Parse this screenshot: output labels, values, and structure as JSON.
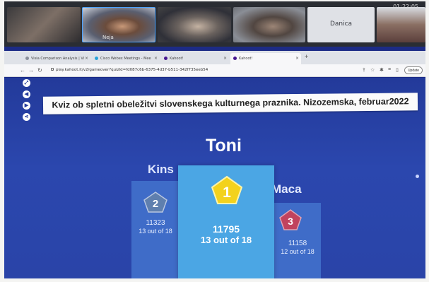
{
  "meeting": {
    "clock": "01:22:05",
    "participants": [
      {
        "name": ""
      },
      {
        "name": "Neja"
      },
      {
        "name": ""
      },
      {
        "name": ""
      },
      {
        "name": "Danica"
      },
      {
        "name": ""
      }
    ]
  },
  "browser": {
    "tabs": [
      {
        "label": "Visia Comparison Analysis | Vi"
      },
      {
        "label": "Cisco Webex Meetings - Mee"
      },
      {
        "label": "Kahoot!"
      },
      {
        "label": "Kahoot!"
      }
    ],
    "url": "play.kahoot.it/v2/gameover?quizId=fd087c6b-6375-4d37-b511-342f735eeb54",
    "update_label": "Update"
  },
  "kahoot": {
    "quiz_title": "Kviz ob spletni obeležitvi slovenskega kulturnega praznika. Nizozemska, februar2022",
    "podium": [
      {
        "rank": "1",
        "name": "Toni",
        "score": "11795",
        "correct": "13 out of 18",
        "color": "#f3d21d"
      },
      {
        "rank": "2",
        "name": "Kins",
        "score": "11323",
        "correct": "13 out of 18",
        "color": "#5f7fae"
      },
      {
        "rank": "3",
        "name": "Maca",
        "score": "11158",
        "correct": "12 out of 18",
        "color": "#c1435e"
      }
    ]
  },
  "colors": {
    "kahoot_bg": "#2a44a8",
    "first_podium": "#4ba6e4",
    "side_podium": "#3f6cc8"
  }
}
